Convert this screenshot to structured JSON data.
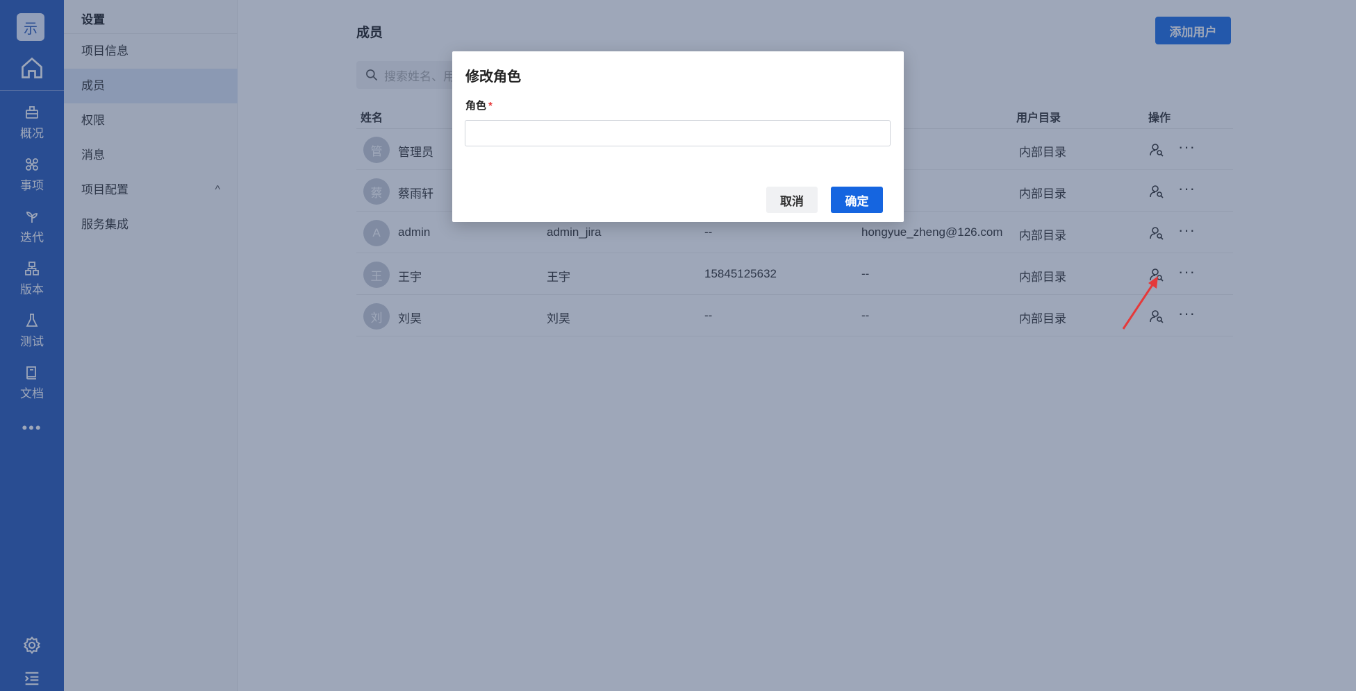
{
  "rail": {
    "logo_text": "示",
    "items": [
      {
        "label": "概况",
        "icon": "briefcase-icon"
      },
      {
        "label": "事项",
        "icon": "cross-icon"
      },
      {
        "label": "迭代",
        "icon": "plant-icon"
      },
      {
        "label": "版本",
        "icon": "sitemap-icon"
      },
      {
        "label": "测试",
        "icon": "flask-icon"
      },
      {
        "label": "文档",
        "icon": "book-icon"
      }
    ],
    "more": "•••"
  },
  "sidebar": {
    "title": "设置",
    "items": [
      {
        "label": "项目信息"
      },
      {
        "label": "成员"
      },
      {
        "label": "权限"
      },
      {
        "label": "消息"
      },
      {
        "label": "项目配置"
      },
      {
        "label": "服务集成"
      }
    ],
    "caret": "^"
  },
  "main": {
    "title": "成员",
    "add_button": "添加用户",
    "search_placeholder": "搜索姓名、用",
    "columns": {
      "name": "姓名",
      "directory": "用户目录",
      "actions": "操作"
    },
    "rows": [
      {
        "avatar": "管",
        "name": "管理员",
        "account": "",
        "phone": "",
        "email": "",
        "directory": "内部目录"
      },
      {
        "avatar": "蔡",
        "name": "蔡雨轩",
        "account": "",
        "phone": "",
        "email": "",
        "directory": "内部目录"
      },
      {
        "avatar": "A",
        "name": "admin",
        "account": "admin_jira",
        "phone": "--",
        "email": "hongyue_zheng@126.com",
        "directory": "内部目录"
      },
      {
        "avatar": "王",
        "name": "王宇",
        "account": "王宇",
        "phone": "15845125632",
        "email": "--",
        "directory": "内部目录"
      },
      {
        "avatar": "刘",
        "name": "刘昊",
        "account": "刘昊",
        "phone": "--",
        "email": "--",
        "directory": "内部目录"
      }
    ],
    "more_label": "···"
  },
  "modal": {
    "title": "修改角色",
    "field_label": "角色",
    "required_mark": "*",
    "input_value": "",
    "cancel": "取消",
    "confirm": "确定"
  },
  "colors": {
    "rail": "#2b5bb8",
    "primary": "#1565e0",
    "required": "#e5393a",
    "annotation_arrow": "#e5393a"
  }
}
